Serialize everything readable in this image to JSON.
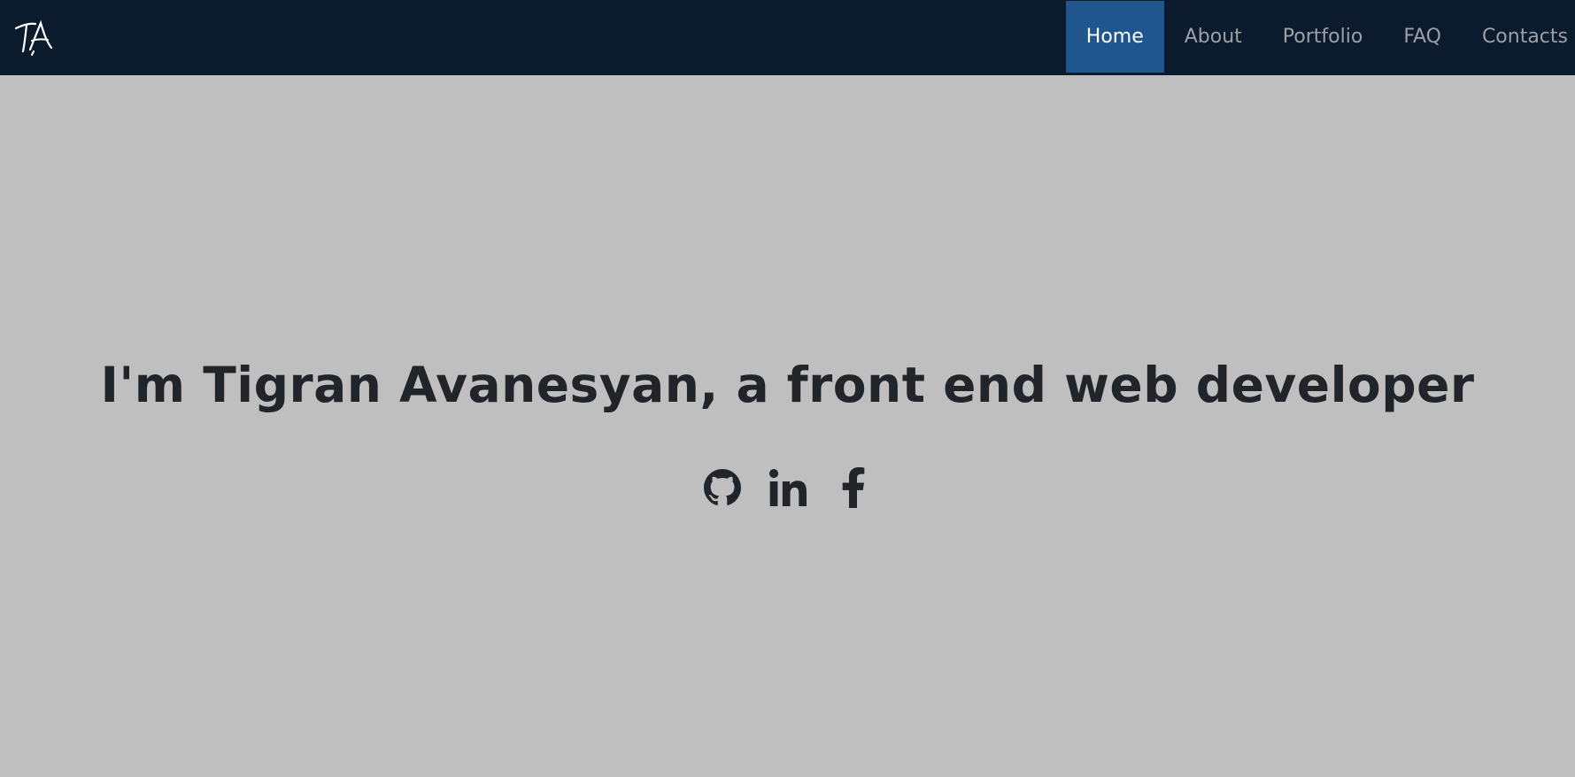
{
  "navbar": {
    "logo_text": "TA",
    "links": [
      {
        "label": "Home",
        "active": true
      },
      {
        "label": "About",
        "active": false
      },
      {
        "label": "Portfolio",
        "active": false
      },
      {
        "label": "FAQ",
        "active": false
      },
      {
        "label": "Contacts",
        "active": false
      }
    ]
  },
  "hero": {
    "headline": "I'm Tigran Avanesyan, a front end web developer",
    "socials": [
      {
        "icon": "github-icon"
      },
      {
        "icon": "linkedin-icon"
      },
      {
        "icon": "facebook-icon"
      }
    ]
  },
  "colors": {
    "navbar_bg": "#0b1a2c",
    "active_link_bg": "#20558e",
    "page_bg": "#bfbfbf",
    "text_dark": "#212529",
    "nav_text": "#9aa0a6"
  }
}
